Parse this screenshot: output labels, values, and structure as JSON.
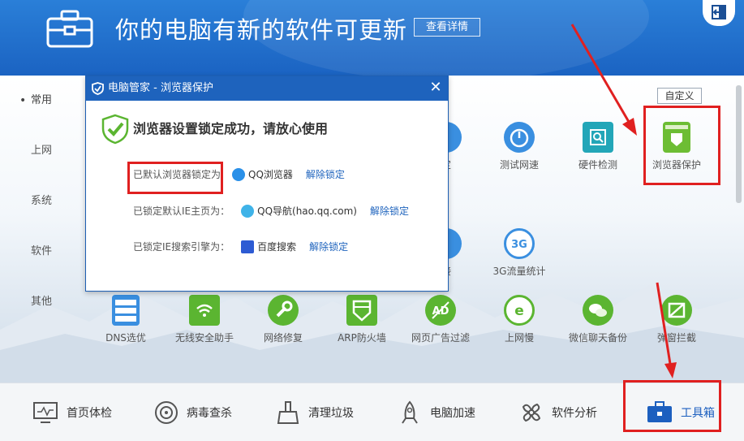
{
  "banner": {
    "title": "你的电脑有新的软件可更新",
    "details_button": "查看详情",
    "icons": [
      "toolbox-icon",
      "exit-icon"
    ]
  },
  "sidebar": {
    "items": [
      {
        "label": "常用",
        "active": true
      },
      {
        "label": "上网"
      },
      {
        "label": "系统"
      },
      {
        "label": "软件"
      },
      {
        "label": "其他"
      }
    ]
  },
  "customize_button": "自定义",
  "tools_row1": [
    {
      "label": "定",
      "icon": "browser-lock-icon"
    },
    {
      "label": "测试网速",
      "icon": "speedometer-icon"
    },
    {
      "label": "硬件检测",
      "icon": "hardware-check-icon"
    },
    {
      "label": "浏览器保护",
      "icon": "browser-protect-icon"
    }
  ],
  "tools_row2": [
    {
      "label": "接",
      "icon": "connect-icon"
    },
    {
      "label": "3G流量统计",
      "icon": "3g-icon"
    }
  ],
  "tools_row3": [
    {
      "label": "DNS选优",
      "icon": "dns-icon"
    },
    {
      "label": "无线安全助手",
      "icon": "wifi-icon"
    },
    {
      "label": "网络修复",
      "icon": "wrench-icon"
    },
    {
      "label": "ARP防火墙",
      "icon": "firewall-icon"
    },
    {
      "label": "网页广告过滤",
      "icon": "ad-filter-icon"
    },
    {
      "label": "上网慢",
      "icon": "slow-net-icon"
    },
    {
      "label": "微信聊天备份",
      "icon": "wechat-icon"
    },
    {
      "label": "弹窗拦截",
      "icon": "popup-block-icon"
    }
  ],
  "bottom_nav": [
    {
      "label": "首页体检",
      "icon": "monitor-icon"
    },
    {
      "label": "病毒查杀",
      "icon": "target-icon"
    },
    {
      "label": "清理垃圾",
      "icon": "broom-icon"
    },
    {
      "label": "电脑加速",
      "icon": "rocket-icon"
    },
    {
      "label": "软件分析",
      "icon": "fan-icon"
    },
    {
      "label": "工具箱",
      "icon": "toolbox-icon",
      "active": true
    }
  ],
  "dialog": {
    "title": "电脑管家 - 浏览器保护",
    "headline": "浏览器设置锁定成功，请放心使用",
    "rows": [
      {
        "label": "已默认浏览器锁定为",
        "value": "QQ浏览器",
        "action": "解除锁定"
      },
      {
        "label": "已锁定默认IE主页为：",
        "value": "QQ导航(hao.qq.com)",
        "action": "解除锁定"
      },
      {
        "label": "已锁定IE搜索引擎为：",
        "value": "百度搜索",
        "action": "解除锁定"
      }
    ]
  },
  "colors": {
    "banner_blue": "#1b63c2",
    "dialog_blue": "#1e63bd",
    "tool_green": "#5bb531",
    "highlight_red": "#e02020"
  }
}
